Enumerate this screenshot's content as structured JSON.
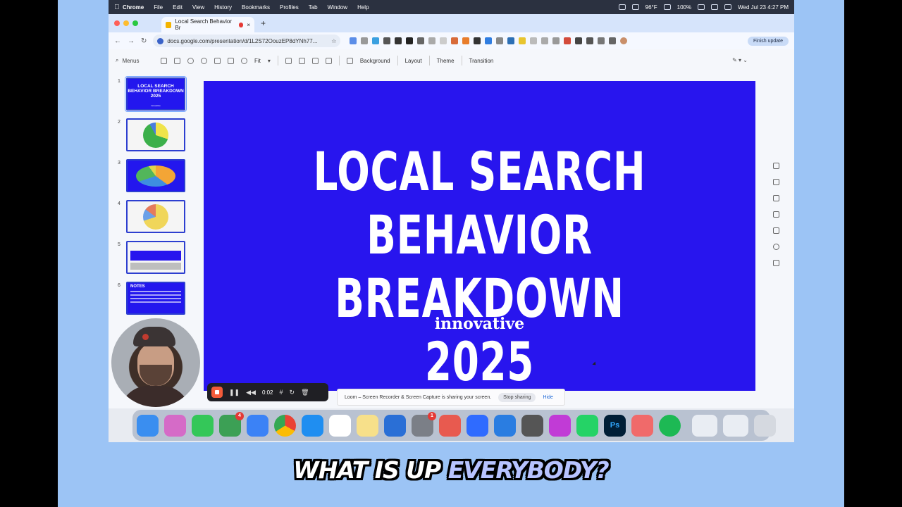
{
  "menubar": {
    "app_name": "Chrome",
    "items": [
      "File",
      "Edit",
      "View",
      "History",
      "Bookmarks",
      "Profiles",
      "Tab",
      "Window",
      "Help"
    ],
    "weather": "96°F",
    "battery": "100%",
    "datetime": "Wed Jul 23  4:27 PM"
  },
  "browser": {
    "tab_title": "Local Search Behavior Br",
    "url": "docs.google.com/presentation/d/1L2S72OouzEP8dYNh77...",
    "finish_update": "Finish update"
  },
  "slides_toolbar": {
    "search_label": "Menus",
    "zoom": "Fit",
    "background": "Background",
    "layout": "Layout",
    "theme": "Theme",
    "transition": "Transition"
  },
  "filmstrip": {
    "numbers": [
      "1",
      "2",
      "3",
      "4",
      "5",
      "6"
    ],
    "thumb1_title": "LOCAL SEARCH BEHAVIOR BREAKDOWN 2025",
    "thumb1_sub": "innovative",
    "thumb6_title": "NOTES"
  },
  "slide": {
    "title_line1": "LOCAL SEARCH BEHAVIOR",
    "title_line2": "BREAKDOWN 2025",
    "brand": "innovative",
    "bg_color": "#2815ee"
  },
  "loom": {
    "timer": "0:02",
    "share_message": "Loom – Screen Recorder & Screen Capture is sharing your screen.",
    "stop_sharing": "Stop sharing",
    "hide": "Hide"
  },
  "dock": {
    "badges": {
      "calendar": "4",
      "settings": "1"
    },
    "ps_label": "Ps"
  },
  "caption": {
    "part1": "WHAT IS UP ",
    "part2": "EVERYBODY?"
  }
}
